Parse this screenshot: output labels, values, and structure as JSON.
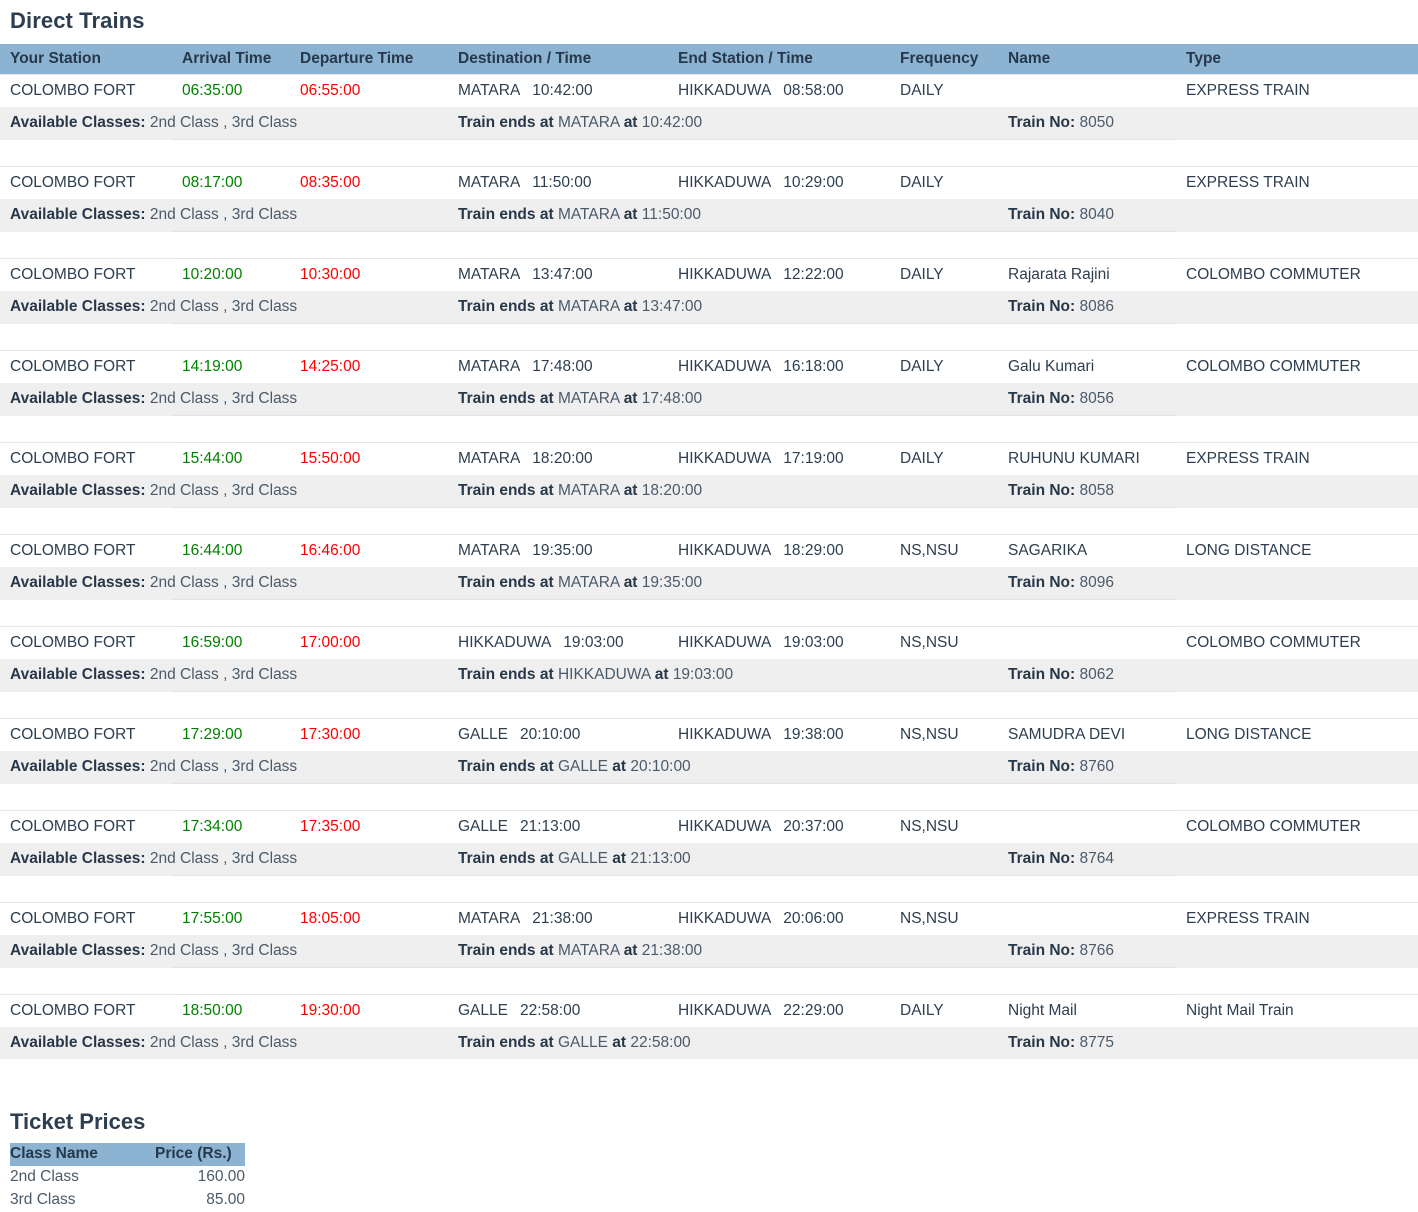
{
  "direct_trains": {
    "title": "Direct Trains",
    "columns": [
      "Your Station",
      "Arrival Time",
      "Departure Time",
      "Destination / Time",
      "End Station / Time",
      "Frequency",
      "Name",
      "Type"
    ],
    "labels": {
      "available_classes": "Available Classes:",
      "train_ends_at": "Train ends at",
      "at": "at",
      "train_no": "Train No:"
    },
    "rows": [
      {
        "station": "COLOMBO FORT",
        "arrival": "06:35:00",
        "departure": "06:55:00",
        "destination": "MATARA",
        "destination_time": "10:42:00",
        "end_station": "HIKKADUWA",
        "end_time": "08:58:00",
        "frequency": "DAILY",
        "name": "",
        "type": "EXPRESS TRAIN",
        "classes": "2nd Class ,  3rd Class",
        "ends_station": "MATARA",
        "ends_time": "10:42:00",
        "train_no": "8050"
      },
      {
        "station": "COLOMBO FORT",
        "arrival": "08:17:00",
        "departure": "08:35:00",
        "destination": "MATARA",
        "destination_time": "11:50:00",
        "end_station": "HIKKADUWA",
        "end_time": "10:29:00",
        "frequency": "DAILY",
        "name": "",
        "type": "EXPRESS TRAIN",
        "classes": "2nd Class ,  3rd Class",
        "ends_station": "MATARA",
        "ends_time": "11:50:00",
        "train_no": "8040"
      },
      {
        "station": "COLOMBO FORT",
        "arrival": "10:20:00",
        "departure": "10:30:00",
        "destination": "MATARA",
        "destination_time": "13:47:00",
        "end_station": "HIKKADUWA",
        "end_time": "12:22:00",
        "frequency": "DAILY",
        "name": "Rajarata Rajini",
        "type": "COLOMBO COMMUTER",
        "classes": "2nd Class ,  3rd Class",
        "ends_station": "MATARA",
        "ends_time": "13:47:00",
        "train_no": "8086"
      },
      {
        "station": "COLOMBO FORT",
        "arrival": "14:19:00",
        "departure": "14:25:00",
        "destination": "MATARA",
        "destination_time": "17:48:00",
        "end_station": "HIKKADUWA",
        "end_time": "16:18:00",
        "frequency": "DAILY",
        "name": "Galu Kumari",
        "type": "COLOMBO COMMUTER",
        "classes": "2nd Class ,  3rd Class",
        "ends_station": "MATARA",
        "ends_time": "17:48:00",
        "train_no": "8056"
      },
      {
        "station": "COLOMBO FORT",
        "arrival": "15:44:00",
        "departure": "15:50:00",
        "destination": "MATARA",
        "destination_time": "18:20:00",
        "end_station": "HIKKADUWA",
        "end_time": "17:19:00",
        "frequency": "DAILY",
        "name": "RUHUNU KUMARI",
        "type": "EXPRESS TRAIN",
        "classes": "2nd Class ,  3rd Class",
        "ends_station": "MATARA",
        "ends_time": "18:20:00",
        "train_no": "8058"
      },
      {
        "station": "COLOMBO FORT",
        "arrival": "16:44:00",
        "departure": "16:46:00",
        "destination": "MATARA",
        "destination_time": "19:35:00",
        "end_station": "HIKKADUWA",
        "end_time": "18:29:00",
        "frequency": "NS,NSU",
        "name": "SAGARIKA",
        "type": "LONG DISTANCE",
        "classes": "2nd Class ,  3rd Class",
        "ends_station": "MATARA",
        "ends_time": "19:35:00",
        "train_no": "8096"
      },
      {
        "station": "COLOMBO FORT",
        "arrival": "16:59:00",
        "departure": "17:00:00",
        "destination": "HIKKADUWA",
        "destination_time": "19:03:00",
        "end_station": "HIKKADUWA",
        "end_time": "19:03:00",
        "frequency": "NS,NSU",
        "name": "",
        "type": "COLOMBO COMMUTER",
        "classes": "2nd Class ,  3rd Class",
        "ends_station": "HIKKADUWA",
        "ends_time": "19:03:00",
        "train_no": "8062"
      },
      {
        "station": "COLOMBO FORT",
        "arrival": "17:29:00",
        "departure": "17:30:00",
        "destination": "GALLE",
        "destination_time": "20:10:00",
        "end_station": "HIKKADUWA",
        "end_time": "19:38:00",
        "frequency": "NS,NSU",
        "name": "SAMUDRA DEVI",
        "type": "LONG DISTANCE",
        "classes": "2nd Class ,  3rd Class",
        "ends_station": "GALLE",
        "ends_time": "20:10:00",
        "train_no": "8760"
      },
      {
        "station": "COLOMBO FORT",
        "arrival": "17:34:00",
        "departure": "17:35:00",
        "destination": "GALLE",
        "destination_time": "21:13:00",
        "end_station": "HIKKADUWA",
        "end_time": "20:37:00",
        "frequency": "NS,NSU",
        "name": "",
        "type": "COLOMBO COMMUTER",
        "classes": "2nd Class ,  3rd Class",
        "ends_station": "GALLE",
        "ends_time": "21:13:00",
        "train_no": "8764"
      },
      {
        "station": "COLOMBO FORT",
        "arrival": "17:55:00",
        "departure": "18:05:00",
        "destination": "MATARA",
        "destination_time": "21:38:00",
        "end_station": "HIKKADUWA",
        "end_time": "20:06:00",
        "frequency": "NS,NSU",
        "name": "",
        "type": "EXPRESS TRAIN",
        "classes": "2nd Class ,  3rd Class",
        "ends_station": "MATARA",
        "ends_time": "21:38:00",
        "train_no": "8766"
      },
      {
        "station": "COLOMBO FORT",
        "arrival": "18:50:00",
        "departure": "19:30:00",
        "destination": "GALLE",
        "destination_time": "22:58:00",
        "end_station": "HIKKADUWA",
        "end_time": "22:29:00",
        "frequency": "DAILY",
        "name": "Night Mail",
        "type": "Night Mail Train",
        "classes": "2nd Class ,  3rd Class",
        "ends_station": "GALLE",
        "ends_time": "22:58:00",
        "train_no": "8775"
      }
    ]
  },
  "ticket_prices": {
    "title": "Ticket Prices",
    "columns": [
      "Class Name",
      "Price (Rs.)"
    ],
    "rows": [
      {
        "class_name": "2nd Class",
        "price": "160.00"
      },
      {
        "class_name": "3rd Class",
        "price": "85.00"
      }
    ]
  },
  "colors": {
    "header_bg": "#8cb4d2",
    "detail_bg": "#efefef",
    "arrival_time": "#008000",
    "departure_time": "#ff0000",
    "text": "#2c3e50"
  }
}
